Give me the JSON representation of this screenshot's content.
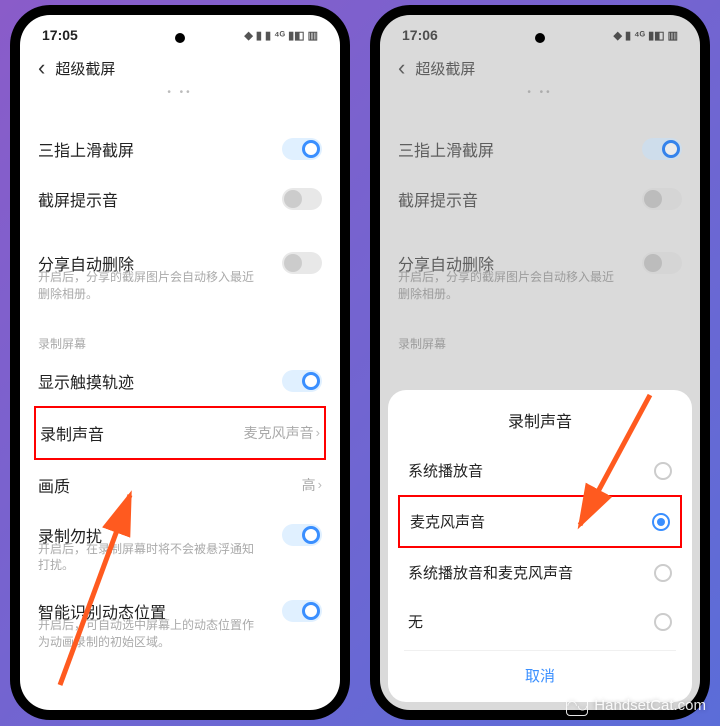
{
  "left": {
    "time": "17:05",
    "page_title": "超级截屏",
    "dots": "• ••",
    "rows": {
      "three_finger": {
        "label": "三指上滑截屏",
        "toggle": "on"
      },
      "sound_hint": {
        "label": "截屏提示音",
        "toggle": "off"
      },
      "auto_delete": {
        "label": "分享自动删除",
        "desc": "开启后，分享的截屏图片会自动移入最近删除相册。"
      },
      "section": "录制屏幕",
      "show_touch": {
        "label": "显示触摸轨迹",
        "toggle": "on"
      },
      "record_audio": {
        "label": "录制声音",
        "value": "麦克风声音"
      },
      "quality": {
        "label": "画质",
        "value": "高"
      },
      "dnd": {
        "label": "录制勿扰",
        "desc": "开启后，在录制屏幕时将不会被悬浮通知打扰。",
        "toggle": "on"
      },
      "smart_pos": {
        "label": "智能识别动态位置",
        "desc": "开启后，可自动选中屏幕上的动态位置作为动画录制的初始区域。",
        "toggle": "on"
      }
    }
  },
  "right": {
    "time": "17:06",
    "page_title": "超级截屏",
    "dots": "• ••",
    "rows": {
      "three_finger": {
        "label": "三指上滑截屏",
        "toggle": "on"
      },
      "sound_hint": {
        "label": "截屏提示音",
        "toggle": "off"
      },
      "auto_delete": {
        "label": "分享自动删除",
        "desc": "开启后，分享的截屏图片会自动移入最近删除相册。"
      },
      "section": "录制屏幕"
    },
    "modal": {
      "title": "录制声音",
      "opt1": "系统播放音",
      "opt2": "麦克风声音",
      "opt3": "系统播放音和麦克风声音",
      "opt4": "无",
      "cancel": "取消"
    }
  },
  "watermark": "HandsetCat.com"
}
